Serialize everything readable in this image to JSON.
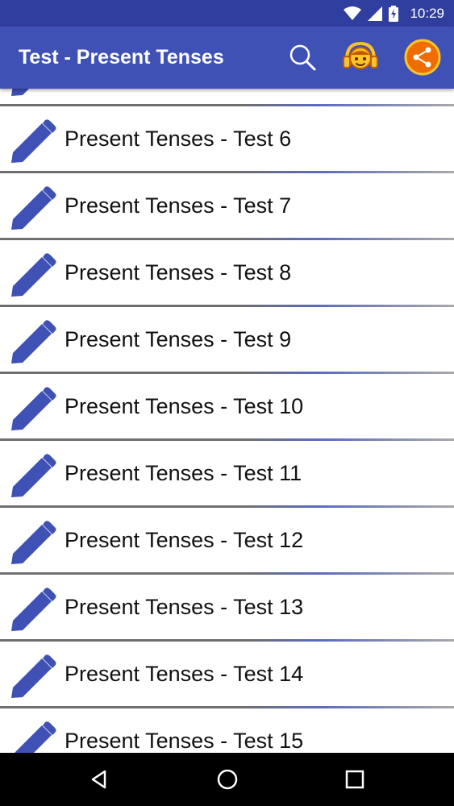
{
  "status_bar": {
    "time": "10:29",
    "icons": [
      "wifi-icon",
      "signal-icon",
      "battery-charging-icon"
    ]
  },
  "app_bar": {
    "title": "Test - Present Tenses",
    "actions": [
      "search-icon",
      "headphones-girl-icon",
      "share-icon"
    ]
  },
  "list": {
    "items": [
      {
        "label": ""
      },
      {
        "label": "Present Tenses - Test 6"
      },
      {
        "label": "Present Tenses - Test 7"
      },
      {
        "label": "Present Tenses - Test 8"
      },
      {
        "label": "Present Tenses - Test 9"
      },
      {
        "label": "Present Tenses - Test 10"
      },
      {
        "label": "Present Tenses - Test 11"
      },
      {
        "label": "Present Tenses - Test 12"
      },
      {
        "label": "Present Tenses - Test 13"
      },
      {
        "label": "Present Tenses - Test 14"
      },
      {
        "label": "Present Tenses - Test 15"
      }
    ]
  },
  "nav_bar": {
    "buttons": [
      "back-icon",
      "home-icon",
      "recents-icon"
    ]
  },
  "colors": {
    "primary": "#3f51b5",
    "primary_dark": "#303f9f",
    "accent_orange": "#ef6c00",
    "accent_yellow": "#f9c32b"
  }
}
